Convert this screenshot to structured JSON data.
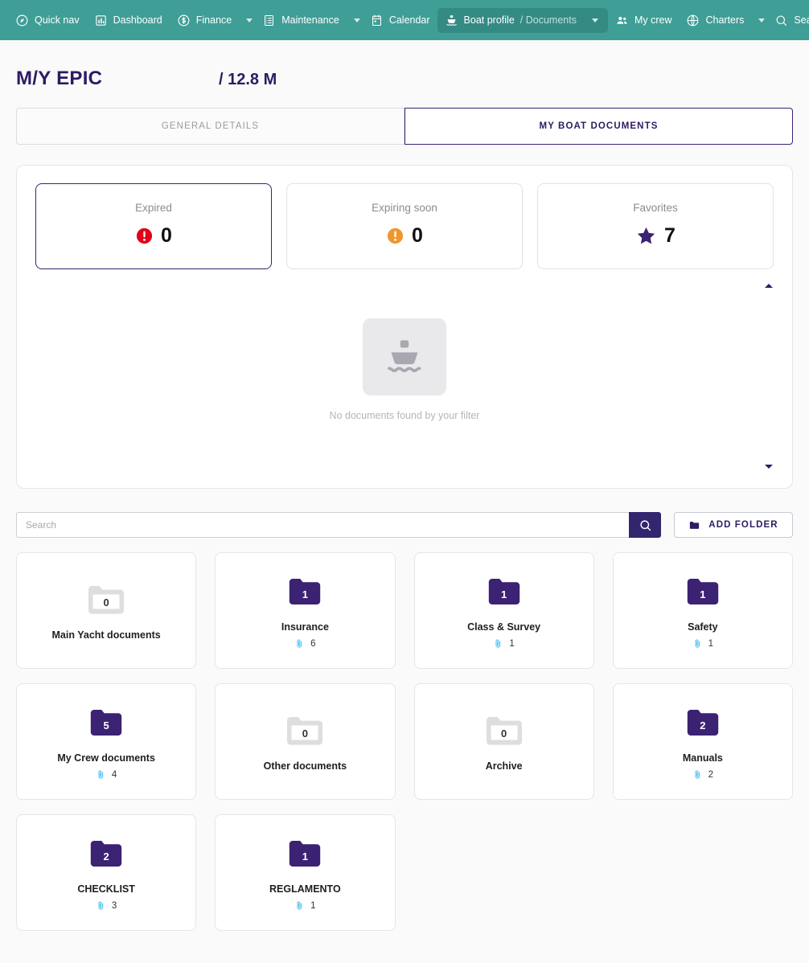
{
  "nav": {
    "items": [
      {
        "label": "Quick nav",
        "icon": "compass-icon",
        "caret": false,
        "active": false
      },
      {
        "label": "Dashboard",
        "icon": "chart-bar-icon",
        "caret": false,
        "active": false
      },
      {
        "label": "Finance",
        "icon": "dollar-circle-icon",
        "caret": true,
        "active": false
      },
      {
        "label": "Maintenance",
        "icon": "list-icon",
        "caret": true,
        "active": false
      },
      {
        "label": "Calendar",
        "icon": "calendar-icon",
        "caret": false,
        "active": false
      },
      {
        "label": "Boat profile",
        "sublabel": "/ Documents",
        "icon": "boat-icon",
        "caret": true,
        "active": true
      },
      {
        "label": "My crew",
        "icon": "people-icon",
        "caret": false,
        "active": false
      },
      {
        "label": "Charters",
        "icon": "globe-icon",
        "caret": true,
        "active": false
      },
      {
        "label": "Search",
        "icon": "search-icon",
        "caret": true,
        "active": false
      }
    ]
  },
  "header": {
    "boat_name": "M/Y EPIC",
    "boat_size": "/ 12.8 M"
  },
  "tabs": [
    {
      "label": "GENERAL DETAILS",
      "active": false
    },
    {
      "label": "MY BOAT DOCUMENTS",
      "active": true
    }
  ],
  "stats": [
    {
      "label": "Expired",
      "value": "0",
      "icon": "exclamation-red-icon",
      "selected": true
    },
    {
      "label": "Expiring soon",
      "value": "0",
      "icon": "exclamation-orange-icon",
      "selected": false
    },
    {
      "label": "Favorites",
      "value": "7",
      "icon": "star-icon",
      "selected": false
    }
  ],
  "empty_state": {
    "icon": "boat-placeholder-icon",
    "text": "No documents found by your filter"
  },
  "search": {
    "value": "",
    "placeholder": "Search",
    "button_icon": "search-icon"
  },
  "add_folder": {
    "label": "ADD FOLDER",
    "icon": "folder-icon"
  },
  "folders": [
    {
      "name": "Main Yacht documents",
      "count": "0",
      "filled": false,
      "attachments": null
    },
    {
      "name": "Insurance",
      "count": "1",
      "filled": true,
      "attachments": "6"
    },
    {
      "name": "Class & Survey",
      "count": "1",
      "filled": true,
      "attachments": "1"
    },
    {
      "name": "Safety",
      "count": "1",
      "filled": true,
      "attachments": "1"
    },
    {
      "name": "My Crew documents",
      "count": "5",
      "filled": true,
      "attachments": "4"
    },
    {
      "name": "Other documents",
      "count": "0",
      "filled": false,
      "attachments": null
    },
    {
      "name": "Archive",
      "count": "0",
      "filled": false,
      "attachments": null
    },
    {
      "name": "Manuals",
      "count": "2",
      "filled": true,
      "attachments": "2"
    },
    {
      "name": "CHECKLIST",
      "count": "2",
      "filled": true,
      "attachments": "3"
    },
    {
      "name": "REGLAMENTO",
      "count": "1",
      "filled": true,
      "attachments": "1"
    }
  ],
  "colors": {
    "nav_bg": "#3f9e96",
    "nav_active": "#348b84",
    "purple": "#3b2272",
    "purple_dark": "#33256e",
    "red": "#e2001a",
    "orange": "#f0962e",
    "cyan": "#52c4f0",
    "folder_empty": "#dedede"
  }
}
